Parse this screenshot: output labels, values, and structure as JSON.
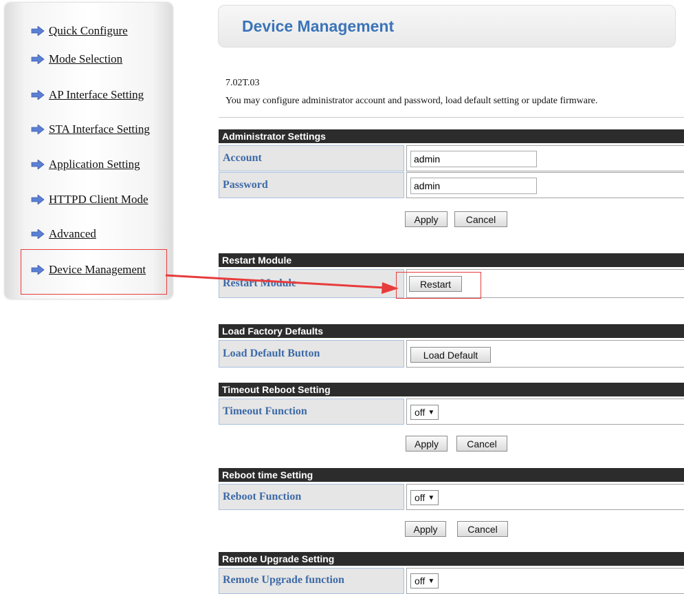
{
  "sidebar": {
    "items": [
      {
        "label": "Quick Configure"
      },
      {
        "label": "Mode Selection"
      },
      {
        "label": "AP Interface Setting"
      },
      {
        "label": "STA Interface Setting"
      },
      {
        "label": "Application Setting"
      },
      {
        "label": "HTTPD Client Mode"
      },
      {
        "label": "Advanced"
      },
      {
        "label": "Device Management"
      }
    ]
  },
  "header": {
    "title": "Device Management"
  },
  "version": "7.02T.03",
  "description": "You may configure administrator account and password, load default setting or update firmware.",
  "admin": {
    "title": "Administrator Settings",
    "account_label": "Account",
    "account_value": "admin",
    "password_label": "Password",
    "password_value": "admin",
    "apply": "Apply",
    "cancel": "Cancel"
  },
  "restart": {
    "title": "Restart Module",
    "label": "Restart Module",
    "button": "Restart"
  },
  "factory": {
    "title": "Load Factory Defaults",
    "label": "Load Default Button",
    "button": "Load Default"
  },
  "timeout": {
    "title": "Timeout Reboot Setting",
    "label": "Timeout Function",
    "value": "off",
    "apply": "Apply",
    "cancel": "Cancel"
  },
  "reboot": {
    "title": "Reboot time Setting",
    "label": "Reboot Function",
    "value": "off",
    "apply": "Apply",
    "cancel": "Cancel"
  },
  "upgrade": {
    "title": "Remote Upgrade Setting",
    "label": "Remote Upgrade function",
    "value": "off"
  },
  "colors": {
    "accent": "#3b74b8",
    "label_blue": "#3d6aa6",
    "section_bar": "#2c2c2c",
    "highlight_red": "#e83b3b",
    "nav_arrow": "#5b7fd3"
  }
}
